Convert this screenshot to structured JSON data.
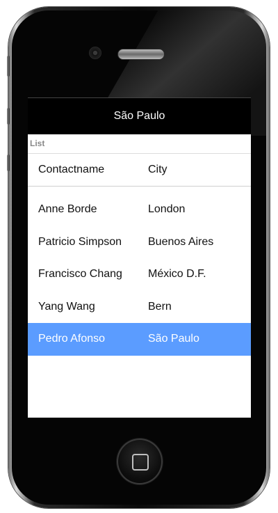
{
  "screen": {
    "title": "São Paulo",
    "list_caption": "List",
    "columns": [
      "Contactname",
      "City"
    ],
    "rows": [
      {
        "name": "Anne Borde",
        "city": "London"
      },
      {
        "name": "Patricio Simpson",
        "city": "Buenos Aires"
      },
      {
        "name": "Francisco Chang",
        "city": "México D.F."
      },
      {
        "name": "Yang Wang",
        "city": "Bern"
      },
      {
        "name": "Pedro Afonso",
        "city": "São Paulo"
      }
    ],
    "selected_index": 4
  },
  "colors": {
    "selected_row": "#5b9cff",
    "title_bar": "#000000"
  },
  "icons": {
    "camera": "camera-icon",
    "speaker": "speaker-icon",
    "home": "home-button-icon"
  }
}
